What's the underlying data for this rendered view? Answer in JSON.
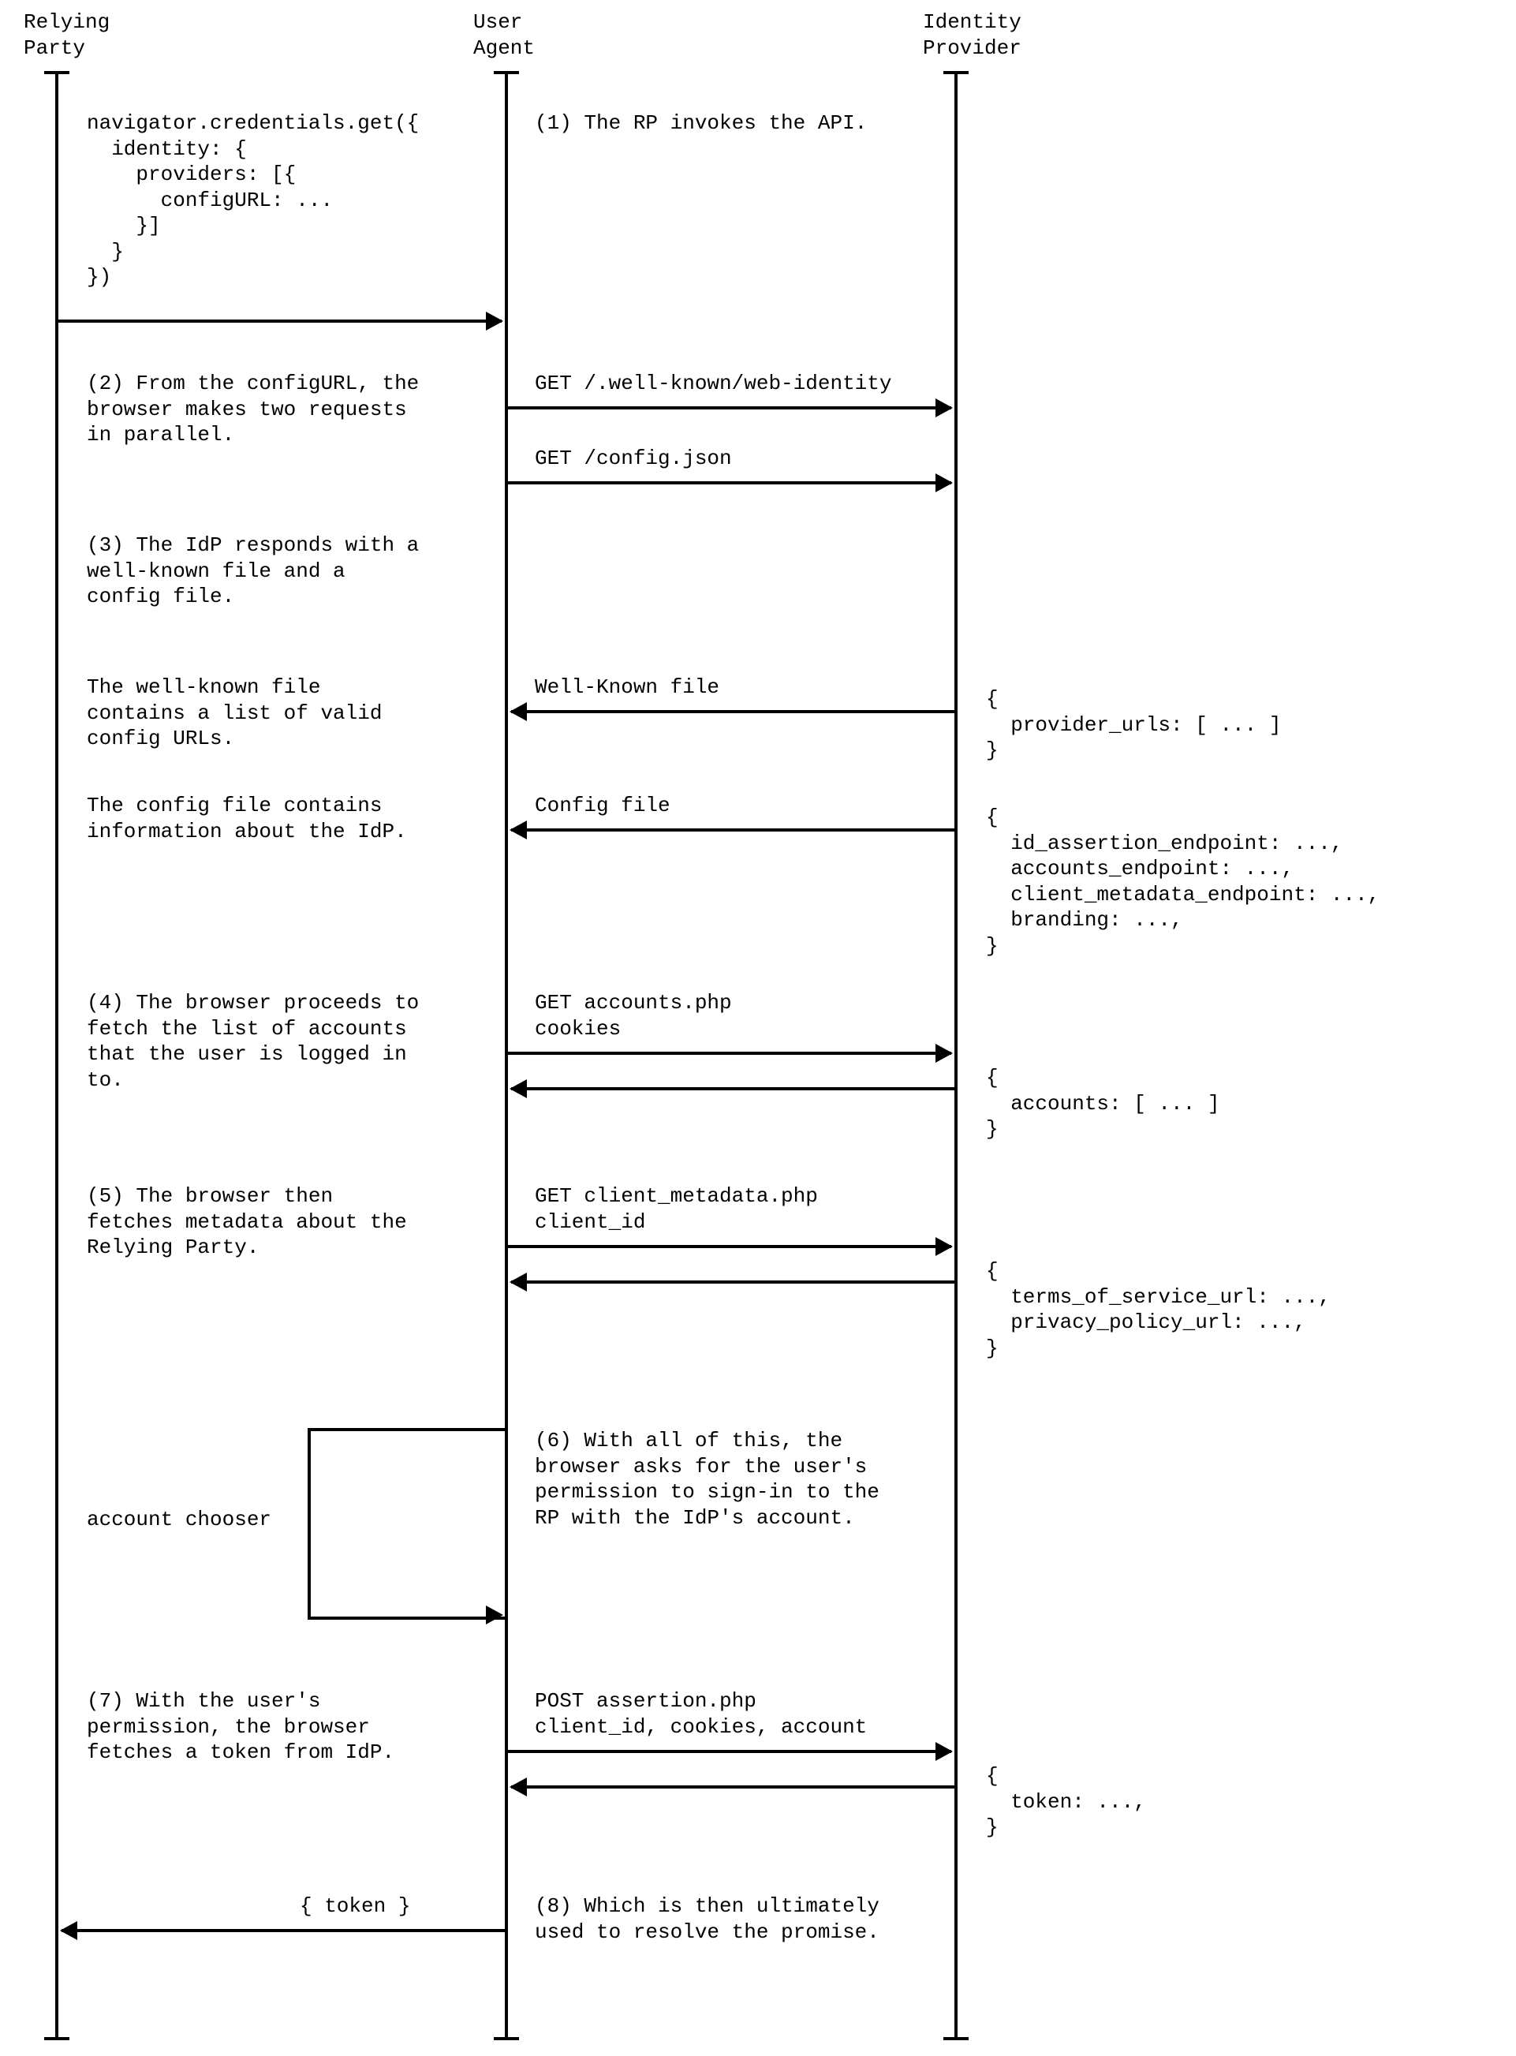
{
  "actors": {
    "rp": "Relying\nParty",
    "ua": "User\nAgent",
    "idp": "Identity\nProvider"
  },
  "s0": {
    "code": "navigator.credentials.get({\n  identity: {\n    providers: [{\n      configURL: ...\n    }]\n  }\n})",
    "note": "(1) The RP invokes the API."
  },
  "s1": {
    "note": "(2) From the configURL, the\nbrowser makes two requests\nin parallel.",
    "msg1": "GET /.well-known/web-identity",
    "msg2": "GET /config.json"
  },
  "s2": {
    "note": "(3) The IdP responds with a\nwell-known file and a\nconfig file."
  },
  "s3a": {
    "note": "The well-known file\ncontains a list of valid\nconfig URLs.",
    "msg": "Well-Known file",
    "resp": "{\n  provider_urls: [ ... ]\n}"
  },
  "s3b": {
    "note": "The config file contains\ninformation about the IdP.",
    "msg": "Config file",
    "resp": "{\n  id_assertion_endpoint: ...,\n  accounts_endpoint: ...,\n  client_metadata_endpoint: ...,\n  branding: ...,\n}"
  },
  "s4": {
    "note": "(4) The browser proceeds to\nfetch the list of accounts\nthat the user is logged in\nto.",
    "msg": "GET accounts.php\ncookies",
    "resp": "{\n  accounts: [ ... ]\n}"
  },
  "s5": {
    "note": "(5) The browser then\nfetches metadata about the\nRelying Party.",
    "msg": "GET client_metadata.php\nclient_id",
    "resp": "{\n  terms_of_service_url: ...,\n  privacy_policy_url: ...,\n}"
  },
  "s6": {
    "self": "account chooser",
    "note": "(6) With all of this, the\nbrowser asks for the user's\npermission to sign-in to the\nRP with the IdP's account."
  },
  "s7": {
    "note": "(7) With the user's\npermission, the browser\nfetches a token from IdP.",
    "msg": "POST assertion.php\nclient_id, cookies, account",
    "resp": "{\n  token: ...,\n}"
  },
  "s8": {
    "ret": "{ token }",
    "note": "(8) Which is then ultimately\nused to resolve the promise."
  }
}
